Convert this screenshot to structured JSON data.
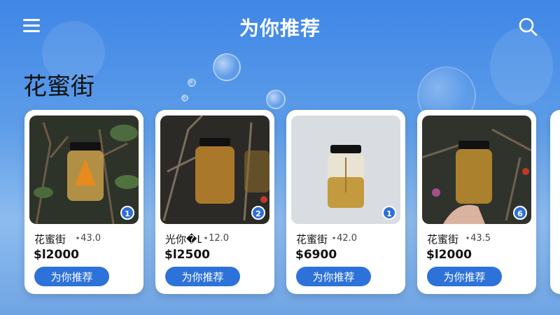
{
  "header": {
    "title": "为你推荐",
    "menu_icon": "menu-icon",
    "search_icon": "search-icon"
  },
  "section": {
    "title": "花蜜街"
  },
  "products": [
    {
      "name": "花蜜街",
      "rating": "⋆43.0",
      "price": "$l2000",
      "badge": "1",
      "button": "为你推荐",
      "image": "honey-jar-branches"
    },
    {
      "name": "光你�London",
      "rating": "⋆12.0",
      "price": "$l2500",
      "badge": "2",
      "button": "为你推荐",
      "image": "honey-jar-branches"
    },
    {
      "name": "花蜜街",
      "rating": "⋆42.0",
      "price": "$6900",
      "badge": "1",
      "button": "为你推荐",
      "image": "honey-jar-studio"
    },
    {
      "name": "花蜜街",
      "rating": "⋆43.5",
      "price": "$l2000",
      "badge": "6",
      "button": "为你推荐",
      "image": "honey-jar-hand"
    }
  ],
  "colors": {
    "accent": "#2d72d9",
    "background": "#4a8de6"
  }
}
